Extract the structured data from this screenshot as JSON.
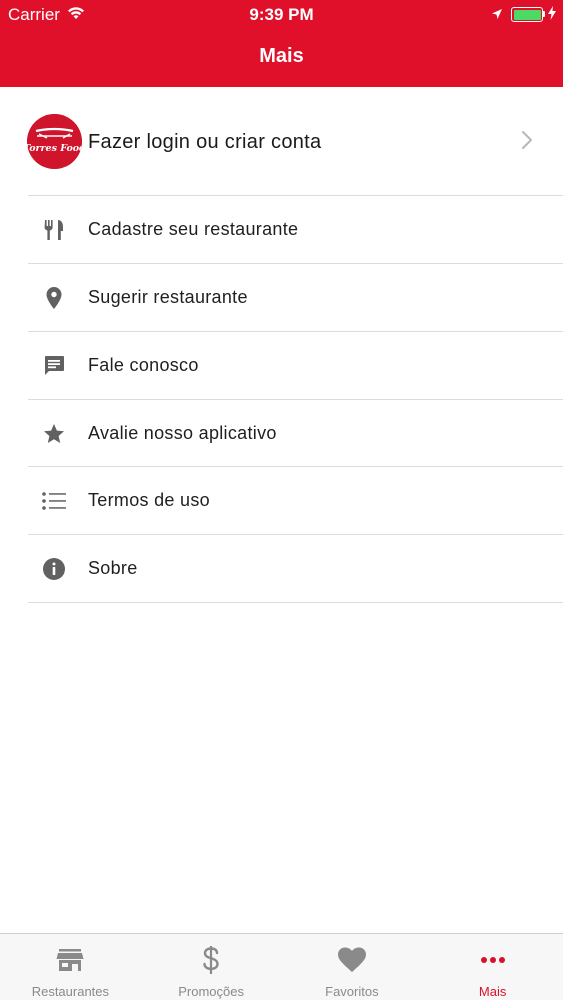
{
  "status_bar": {
    "carrier": "Carrier",
    "time": "9:39 PM",
    "battery_color": "#4cd964"
  },
  "header": {
    "title": "Mais",
    "background_color": "#e0102a"
  },
  "login": {
    "label": "Fazer login ou criar conta",
    "logo_text": "Torres Food"
  },
  "menu": {
    "items": [
      {
        "label": "Cadastre seu restaurante",
        "icon": "fork-knife-icon"
      },
      {
        "label": "Sugerir restaurante",
        "icon": "location-pin-icon"
      },
      {
        "label": "Fale conosco",
        "icon": "chat-bubble-icon"
      },
      {
        "label": "Avalie nosso aplicativo",
        "icon": "star-icon"
      },
      {
        "label": "Termos de uso",
        "icon": "list-icon"
      },
      {
        "label": "Sobre",
        "icon": "info-icon"
      }
    ]
  },
  "tab_bar": {
    "tabs": [
      {
        "label": "Restaurantes",
        "icon": "store-icon",
        "active": false
      },
      {
        "label": "Promoções",
        "icon": "dollar-icon",
        "active": false
      },
      {
        "label": "Favoritos",
        "icon": "heart-icon",
        "active": false
      },
      {
        "label": "Mais",
        "icon": "more-dots-icon",
        "active": true
      }
    ],
    "active_color": "#d9122a",
    "inactive_color": "#8a8a8a"
  }
}
